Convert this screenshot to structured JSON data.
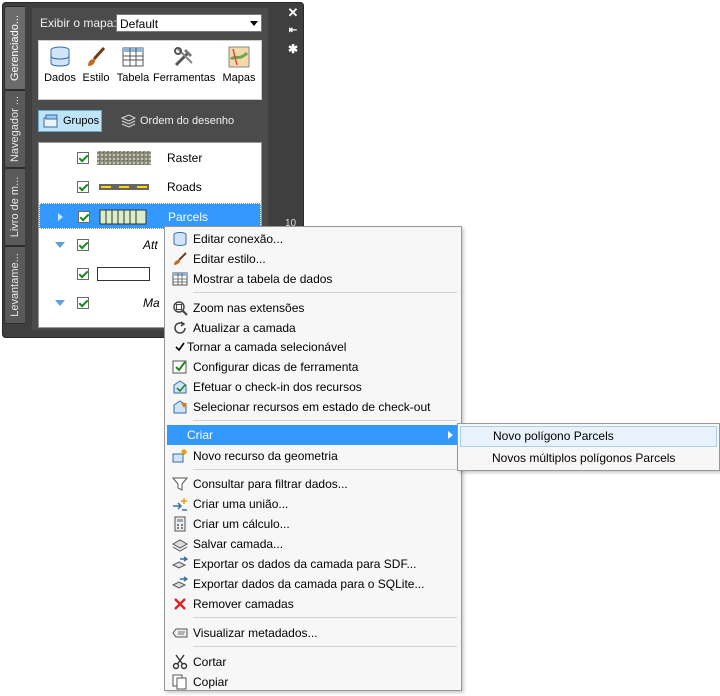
{
  "pane": {
    "tabs": [
      "Gerenciado...",
      "Navegador ...",
      "Livro de m...",
      "Levantame..."
    ],
    "map_label": "Exibir o mapa:",
    "map_value": "Default",
    "toolbar": [
      "Dados",
      "Estilo",
      "Tabela",
      "Ferramentas",
      "Mapas"
    ],
    "groups_label": "Grupos",
    "order_label": "Ordem do desenho",
    "layers": [
      {
        "name": "Raster",
        "checked": true
      },
      {
        "name": "Roads",
        "checked": true
      },
      {
        "name": "Parcels",
        "checked": true,
        "selected": true
      },
      {
        "name": "Att",
        "checked": true
      },
      {
        "name": "",
        "checked": true
      },
      {
        "name": "Ma",
        "checked": true
      }
    ],
    "side_number": "10"
  },
  "menu": {
    "items": [
      {
        "label": "Editar conexão...",
        "icon": "database-icon"
      },
      {
        "label": "Editar estilo...",
        "icon": "brush-icon"
      },
      {
        "label": "Mostrar a tabela de dados",
        "icon": "table-icon"
      },
      {
        "label": "Zoom nas extensões",
        "icon": "zoom-extents-icon"
      },
      {
        "label": "Atualizar a camada",
        "icon": "refresh-icon"
      },
      {
        "label": "Tornar a camada selecionável",
        "icon": "check-icon"
      },
      {
        "label": "Configurar dicas de ferramenta",
        "icon": "tooltip-icon"
      },
      {
        "label": "Efetuar o check-in dos recursos",
        "icon": "checkin-icon"
      },
      {
        "label": "Selecionar recursos em estado de check-out",
        "icon": "checkout-icon"
      },
      {
        "label": "Criar",
        "icon": ""
      },
      {
        "label": "Novo recurso da geometria",
        "icon": "new-feature-icon"
      },
      {
        "label": "Consultar para filtrar dados...",
        "icon": "filter-icon"
      },
      {
        "label": "Criar uma união...",
        "icon": "join-icon"
      },
      {
        "label": "Criar um cálculo...",
        "icon": "calculator-icon"
      },
      {
        "label": "Salvar camada...",
        "icon": "save-layer-icon"
      },
      {
        "label": "Exportar os dados da camada para SDF...",
        "icon": "export-sdf-icon"
      },
      {
        "label": "Exportar dados da camada para o SQLite...",
        "icon": "export-sqlite-icon"
      },
      {
        "label": "Remover camadas",
        "icon": "remove-icon"
      },
      {
        "label": "Visualizar metadados...",
        "icon": "metadata-icon"
      },
      {
        "label": "Cortar",
        "icon": "scissors-icon"
      },
      {
        "label": "Copiar",
        "icon": "copy-icon"
      }
    ],
    "submenu": [
      "Novo polígono Parcels",
      "Novos múltiplos polígonos Parcels"
    ]
  },
  "colors": {
    "highlight": "#3399ff",
    "pane": "#3f3f3f",
    "menu_bg": "#f7f7f7"
  }
}
